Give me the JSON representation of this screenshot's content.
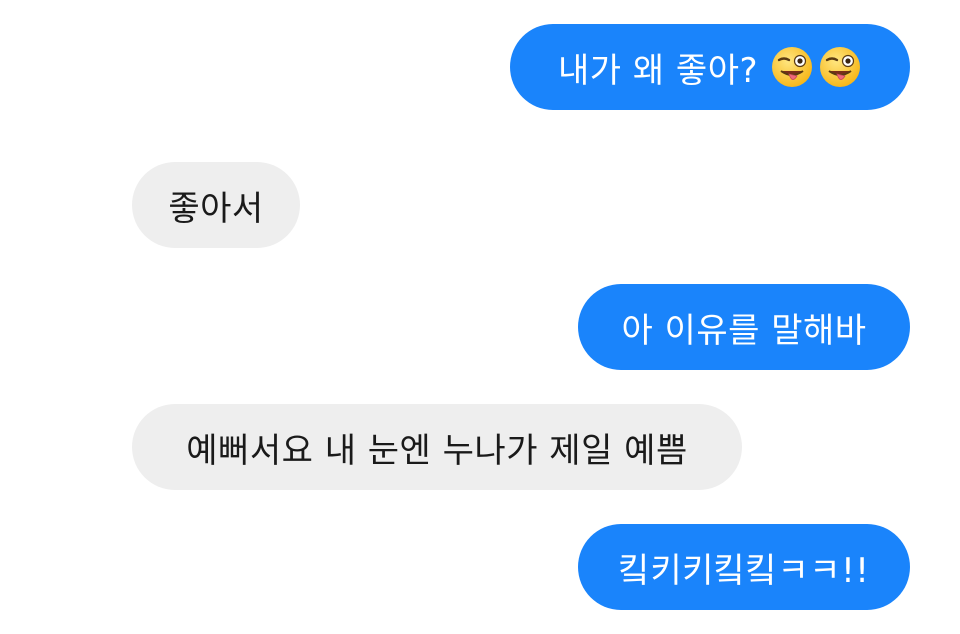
{
  "conversation": {
    "messages": [
      {
        "side": "outgoing",
        "text": "내가 왜 좋아?",
        "emoji": [
          "winking-face-with-tongue-icon",
          "winking-face-with-tongue-icon"
        ]
      },
      {
        "side": "incoming",
        "text": "좋아서"
      },
      {
        "side": "outgoing",
        "text": "아 이유를 말해바"
      },
      {
        "side": "incoming",
        "text": "예뻐서요 내 눈엔 누나가 제일 예쁨"
      },
      {
        "side": "outgoing",
        "text": "킼키키킼킼ㅋㅋ!!"
      }
    ]
  },
  "colors": {
    "outgoing_bubble": "#1a84fb",
    "incoming_bubble": "#eeeeee",
    "outgoing_text": "#ffffff",
    "incoming_text": "#1a1a1a",
    "background": "#ffffff"
  }
}
